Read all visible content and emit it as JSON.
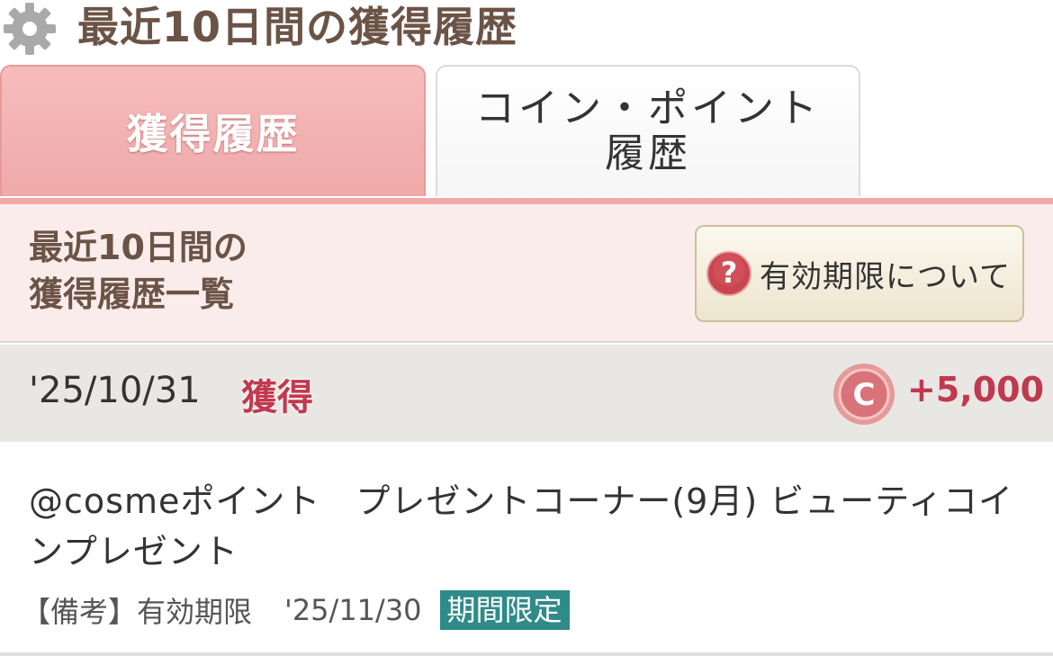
{
  "header": {
    "title": "最近10日間の獲得履歴",
    "icon": "gear-icon"
  },
  "tabs": [
    {
      "label": "獲得履歴",
      "active": true
    },
    {
      "label": "コイン・ポイント履歴",
      "active": false
    }
  ],
  "section": {
    "title": "最近10日間の\n獲得履歴一覧",
    "expiry_button": "有効期限について"
  },
  "entries": [
    {
      "date": "'25/10/31",
      "type": "獲得",
      "amount": "+5,000",
      "description": "@cosmeポイント　プレゼントコーナー(9月) ビューティコインプレゼント",
      "note_label": "【備考】有効期限",
      "note_date": "'25/11/30",
      "badge": "期間限定"
    }
  ],
  "colors": {
    "accent_pink": "#f0a9a9",
    "title_brown": "#6b5346",
    "amount_red": "#c0394e",
    "badge_teal": "#2f8a8a"
  }
}
